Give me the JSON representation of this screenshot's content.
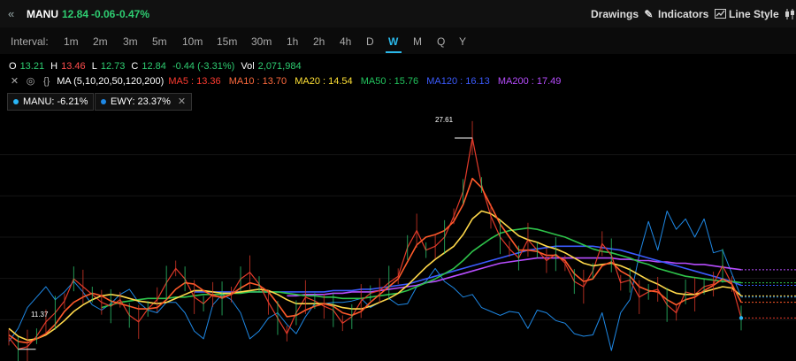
{
  "header": {
    "symbol": "MANU",
    "last": "12.84",
    "change": "-0.06",
    "change_pct": "-0.47%",
    "tools": {
      "drawings": "Drawings",
      "indicators": "Indicators",
      "line_style": "Line Style"
    }
  },
  "intervals": {
    "label": "Interval:",
    "items": [
      "1m",
      "2m",
      "3m",
      "5m",
      "10m",
      "15m",
      "30m",
      "1h",
      "2h",
      "4h",
      "D",
      "W",
      "M",
      "Q",
      "Y"
    ],
    "active": "W"
  },
  "ohlc": {
    "o_label": "O",
    "o": "13.21",
    "h_label": "H",
    "h": "13.46",
    "l_label": "L",
    "l": "12.73",
    "c_label": "C",
    "c": "12.84",
    "chg": "-0.44 (-3.31%)",
    "vol_label": "Vol",
    "vol": "2,071,984"
  },
  "ma": {
    "title": "MA (5,10,20,50,120,200)",
    "values": [
      {
        "name": "MA5 : 13.36",
        "color": "#ff3b30"
      },
      {
        "name": "MA10 : 13.70",
        "color": "#ff6a3d"
      },
      {
        "name": "MA20 : 14.54",
        "color": "#ffe135"
      },
      {
        "name": "MA50 : 15.76",
        "color": "#22c55e"
      },
      {
        "name": "MA120 : 16.13",
        "color": "#3b5bff"
      },
      {
        "name": "MA200 : 17.49",
        "color": "#b84dff"
      }
    ]
  },
  "compare": [
    {
      "label": "MANU: -6.21%",
      "color": "#29b6f6"
    },
    {
      "label": "EWY: 23.37%",
      "color": "#1e88e5"
    }
  ],
  "chart_data": {
    "type": "line",
    "high_label": "27.61",
    "low_label": "11.37",
    "ylim": [
      10.5,
      29.5
    ],
    "series": [
      {
        "name": "MANU",
        "color": "#e23a2a",
        "values": [
          12.3,
          11.4,
          11.6,
          12.4,
          13.5,
          14.2,
          15.1,
          16.8,
          16.2,
          15.6,
          15.0,
          14.7,
          15.2,
          14.0,
          13.5,
          14.5,
          15.2,
          16.5,
          17.6,
          16.8,
          15.4,
          14.9,
          15.6,
          15.3,
          15.6,
          16.8,
          17.3,
          16.4,
          15.0,
          13.8,
          12.6,
          14.2,
          15.4,
          15.1,
          14.7,
          14.4,
          13.4,
          13.9,
          15.1,
          15.7,
          15.9,
          16.5,
          17.0,
          19.2,
          20.5,
          19.0,
          19.3,
          20.0,
          21.6,
          23.5,
          27.6,
          24.0,
          21.6,
          20.0,
          19.1,
          18.4,
          19.8,
          19.0,
          18.2,
          18.7,
          18.0,
          16.6,
          16.2,
          17.4,
          19.5,
          18.6,
          16.5,
          16.7,
          15.4,
          15.8,
          16.0,
          14.8,
          14.2,
          15.8,
          15.6,
          16.2,
          16.4,
          17.8,
          16.4,
          13.8
        ]
      },
      {
        "name": "MA5",
        "color": "#ff5a2a",
        "values": [
          12.5,
          12.0,
          11.9,
          12.2,
          12.6,
          13.3,
          14.3,
          15.0,
          15.4,
          15.7,
          15.5,
          15.1,
          14.9,
          14.7,
          14.5,
          14.5,
          14.6,
          15.2,
          16.0,
          16.5,
          16.4,
          15.9,
          15.5,
          15.4,
          15.6,
          16.1,
          16.5,
          16.3,
          15.8,
          14.9,
          13.9,
          14.0,
          14.4,
          14.7,
          14.9,
          14.7,
          14.2,
          14.0,
          14.3,
          15.0,
          15.6,
          16.2,
          16.8,
          18.1,
          19.4,
          20.0,
          20.2,
          20.5,
          21.2,
          22.5,
          24.5,
          23.8,
          22.4,
          21.0,
          20.0,
          19.0,
          19.0,
          18.9,
          18.6,
          18.6,
          18.2,
          17.2,
          16.6,
          16.8,
          17.8,
          18.1,
          17.4,
          17.0,
          16.2,
          15.9,
          15.8,
          15.2,
          14.8,
          15.2,
          15.4,
          15.9,
          16.3,
          16.8,
          16.4,
          15.0
        ]
      },
      {
        "name": "MA20",
        "color": "#ffd84a",
        "values": [
          13.0,
          12.4,
          12.1,
          12.2,
          12.5,
          13.0,
          13.6,
          14.3,
          14.8,
          15.2,
          15.5,
          15.6,
          15.5,
          15.3,
          15.1,
          15.0,
          14.9,
          15.0,
          15.3,
          15.6,
          15.9,
          15.9,
          15.8,
          15.7,
          15.7,
          15.8,
          15.9,
          16.0,
          15.9,
          15.6,
          15.2,
          14.9,
          14.9,
          14.9,
          14.9,
          14.8,
          14.6,
          14.5,
          14.5,
          14.7,
          15.0,
          15.3,
          15.7,
          16.3,
          17.0,
          17.7,
          18.3,
          18.8,
          19.3,
          20.2,
          21.4,
          22.0,
          21.8,
          21.3,
          20.7,
          20.1,
          19.8,
          19.6,
          19.3,
          19.1,
          18.8,
          18.4,
          18.0,
          17.8,
          17.9,
          18.0,
          17.8,
          17.5,
          17.1,
          16.7,
          16.4,
          16.0,
          15.7,
          15.6,
          15.6,
          15.8,
          16.0,
          16.2,
          16.1,
          15.5
        ]
      },
      {
        "name": "MA50",
        "color": "#2ec24a",
        "values": [
          null,
          null,
          null,
          null,
          null,
          null,
          null,
          null,
          null,
          null,
          14.6,
          14.8,
          15.0,
          15.1,
          15.2,
          15.3,
          15.3,
          15.3,
          15.4,
          15.4,
          15.5,
          15.6,
          15.6,
          15.6,
          15.7,
          15.7,
          15.8,
          15.8,
          15.8,
          15.8,
          15.7,
          15.6,
          15.5,
          15.5,
          15.4,
          15.4,
          15.3,
          15.3,
          15.3,
          15.4,
          15.5,
          15.6,
          15.7,
          15.9,
          16.2,
          16.5,
          16.8,
          17.2,
          17.6,
          18.2,
          18.9,
          19.4,
          19.9,
          20.3,
          20.5,
          20.6,
          20.7,
          20.6,
          20.4,
          20.2,
          20.0,
          19.7,
          19.4,
          19.1,
          18.9,
          18.8,
          18.6,
          18.4,
          18.1,
          17.9,
          17.6,
          17.4,
          17.2,
          17.0,
          16.9,
          16.8,
          16.7,
          16.6,
          16.6,
          16.5
        ]
      },
      {
        "name": "MA120",
        "color": "#3b5bff",
        "values": [
          null,
          null,
          null,
          null,
          null,
          null,
          null,
          null,
          null,
          null,
          null,
          null,
          null,
          null,
          null,
          null,
          null,
          null,
          null,
          null,
          15.8,
          15.8,
          15.8,
          15.8,
          15.8,
          15.8,
          15.8,
          15.8,
          15.8,
          15.8,
          15.8,
          15.8,
          15.8,
          15.8,
          15.8,
          15.9,
          15.9,
          15.9,
          16.0,
          16.0,
          16.1,
          16.2,
          16.3,
          16.4,
          16.6,
          16.8,
          17.0,
          17.2,
          17.4,
          17.6,
          17.8,
          18.0,
          18.2,
          18.4,
          18.6,
          18.8,
          19.0,
          19.1,
          19.2,
          19.3,
          19.3,
          19.3,
          19.3,
          19.3,
          19.2,
          19.1,
          19.0,
          18.8,
          18.6,
          18.4,
          18.2,
          18.0,
          17.8,
          17.6,
          17.4,
          17.2,
          17.0,
          16.8,
          16.6,
          16.3
        ]
      },
      {
        "name": "MA200",
        "color": "#b84dff",
        "values": [
          null,
          null,
          null,
          null,
          null,
          null,
          null,
          null,
          null,
          null,
          null,
          null,
          null,
          null,
          null,
          null,
          null,
          null,
          null,
          null,
          null,
          null,
          null,
          null,
          null,
          null,
          null,
          null,
          null,
          null,
          15.5,
          15.5,
          15.6,
          15.6,
          15.6,
          15.7,
          15.7,
          15.8,
          15.8,
          15.8,
          15.9,
          16.0,
          16.1,
          16.2,
          16.3,
          16.5,
          16.6,
          16.8,
          17.0,
          17.2,
          17.4,
          17.6,
          17.8,
          18.0,
          18.1,
          18.2,
          18.3,
          18.4,
          18.4,
          18.4,
          18.4,
          18.4,
          18.4,
          18.4,
          18.4,
          18.4,
          18.3,
          18.3,
          18.2,
          18.2,
          18.1,
          18.1,
          18.0,
          18.0,
          17.9,
          17.9,
          17.8,
          17.7,
          17.6,
          17.5
        ]
      },
      {
        "name": "EWY",
        "color": "#1e88e5",
        "values": [
          12.0,
          13.0,
          14.6,
          15.4,
          16.2,
          15.2,
          15.8,
          16.6,
          15.8,
          14.8,
          14.4,
          14.9,
          15.6,
          16.0,
          15.0,
          14.4,
          14.2,
          15.0,
          15.0,
          14.2,
          12.8,
          12.2,
          14.8,
          15.6,
          15.2,
          14.2,
          12.2,
          12.8,
          13.8,
          14.2,
          13.3,
          12.6,
          13.9,
          14.9,
          14.9,
          15.0,
          15.0,
          15.1,
          15.3,
          14.6,
          15.0,
          15.3,
          14.8,
          14.9,
          16.2,
          16.6,
          17.6,
          16.6,
          16.1,
          15.4,
          15.6,
          14.6,
          14.3,
          14.0,
          14.3,
          14.2,
          13.0,
          14.4,
          14.2,
          13.6,
          13.4,
          12.6,
          12.4,
          12.5,
          14.2,
          11.3,
          14.2,
          15.2,
          18.6,
          21.2,
          19.0,
          22.0,
          20.6,
          21.4,
          20.0,
          21.4,
          18.8,
          19.0,
          17.2,
          15.4
        ]
      }
    ]
  }
}
